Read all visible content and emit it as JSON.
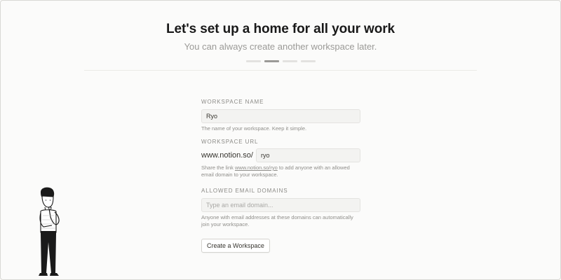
{
  "header": {
    "title": "Let's set up a home for all your work",
    "subtitle": "You can always create another workspace later.",
    "progress": {
      "total_steps": 4,
      "current_step": 2
    }
  },
  "form": {
    "workspace_name": {
      "label": "Workspace Name",
      "value": "Ryo",
      "help": "The name of your workspace. Keep it simple."
    },
    "workspace_url": {
      "label": "Workspace URL",
      "prefix": "www.notion.so/",
      "value": "ryo",
      "help_before": "Share the link ",
      "help_link": "www.notion.so/ryo",
      "help_after": " to add anyone with an allowed email domain to your workspace."
    },
    "allowed_domains": {
      "label": "Allowed Email Domains",
      "placeholder": "Type an email domain...",
      "help": "Anyone with email addresses at these domains can automatically join your workspace."
    },
    "submit_label": "Create a Workspace"
  },
  "illustration": {
    "icon": "thinking-person-icon"
  }
}
